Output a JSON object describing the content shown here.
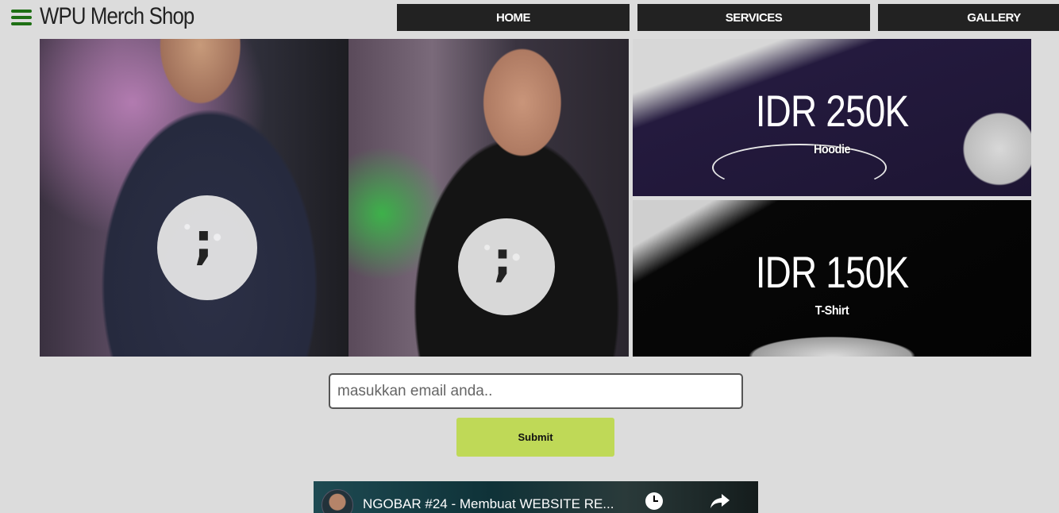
{
  "header": {
    "brand": "WPU Merch Shop",
    "nav": [
      {
        "label": "HOME"
      },
      {
        "label": "SERVICES"
      },
      {
        "label": "GALLERY"
      }
    ]
  },
  "products": [
    {
      "price": "IDR 250K",
      "name": "Hoodie"
    },
    {
      "price": "IDR 150K",
      "name": "T-Shirt"
    }
  ],
  "form": {
    "email_placeholder": "masukkan email anda..",
    "submit_label": "Submit"
  },
  "video": {
    "title": "NGOBAR #24 - Membuat WEBSITE RE..."
  },
  "colors": {
    "accent_green": "#1e6f14",
    "submit_bg": "#bfd957",
    "nav_bg": "#222222",
    "page_bg": "#dcdcdc"
  },
  "icons": [
    "hamburger-menu-icon",
    "clock-icon",
    "share-icon"
  ]
}
